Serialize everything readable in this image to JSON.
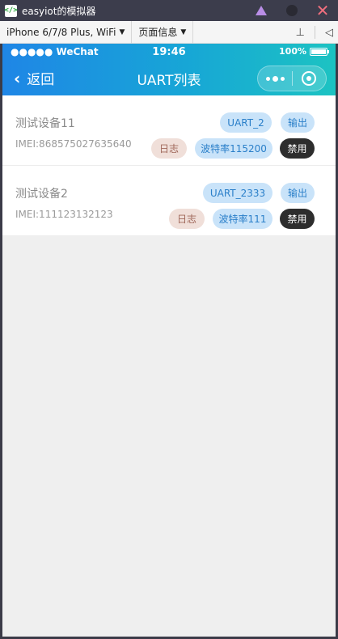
{
  "window": {
    "title": "easyiot的模拟器",
    "app_icon": "</>"
  },
  "toolbar": {
    "device": "iPhone 6/7/8 Plus, WiFi",
    "page_info": "页面信息"
  },
  "status": {
    "signal": "●●●●● WeChat",
    "time": "19:46",
    "battery": "100%"
  },
  "nav": {
    "back_label": "返回",
    "title": "UART列表"
  },
  "devices": [
    {
      "name": "测试设备11",
      "imei": "IMEI:868575027635640",
      "uart": "UART_2",
      "output": "输出",
      "log": "日志",
      "baud": "波特率115200",
      "disable": "禁用"
    },
    {
      "name": "测试设备2",
      "imei": "IMEI:111123132123",
      "uart": "UART_2333",
      "output": "输出",
      "log": "日志",
      "baud": "波特率111",
      "disable": "禁用"
    }
  ],
  "colors": {
    "nav_start": "#1f86e6",
    "nav_end": "#1cc3c2",
    "tag_blue": "#c9e3f9",
    "tag_log": "#f0dfd9",
    "tag_dark": "#2d2d2d"
  }
}
